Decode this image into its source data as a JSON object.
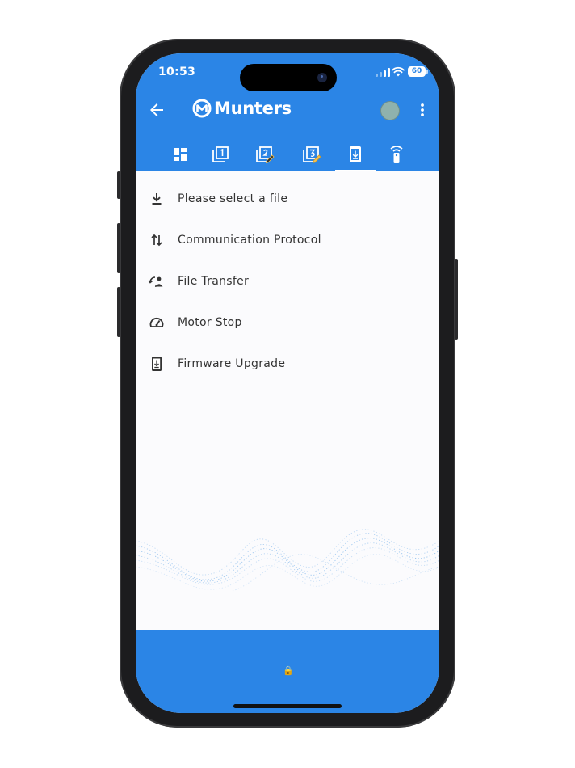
{
  "status_bar": {
    "time": "10:53",
    "battery": "60"
  },
  "app_bar": {
    "brand": "Munters"
  },
  "tabs": [
    {
      "icon": "dashboard-icon"
    },
    {
      "icon": "page-one-icon"
    },
    {
      "icon": "page-two-edit-icon"
    },
    {
      "icon": "page-edit-icon"
    },
    {
      "icon": "device-download-icon",
      "active": true
    },
    {
      "icon": "remote-control-icon"
    }
  ],
  "menu": {
    "items": [
      {
        "label": "Please select a file",
        "icon": "download-icon"
      },
      {
        "label": "Communication Protocol",
        "icon": "swap-vert-icon"
      },
      {
        "label": "File Transfer",
        "icon": "file-transfer-icon"
      },
      {
        "label": "Motor Stop",
        "icon": "speedometer-icon"
      },
      {
        "label": "Firmware Upgrade",
        "icon": "phone-download-icon"
      }
    ]
  },
  "colors": {
    "primary": "#2b85e6",
    "background": "#fbfbfd",
    "text": "#333333"
  }
}
